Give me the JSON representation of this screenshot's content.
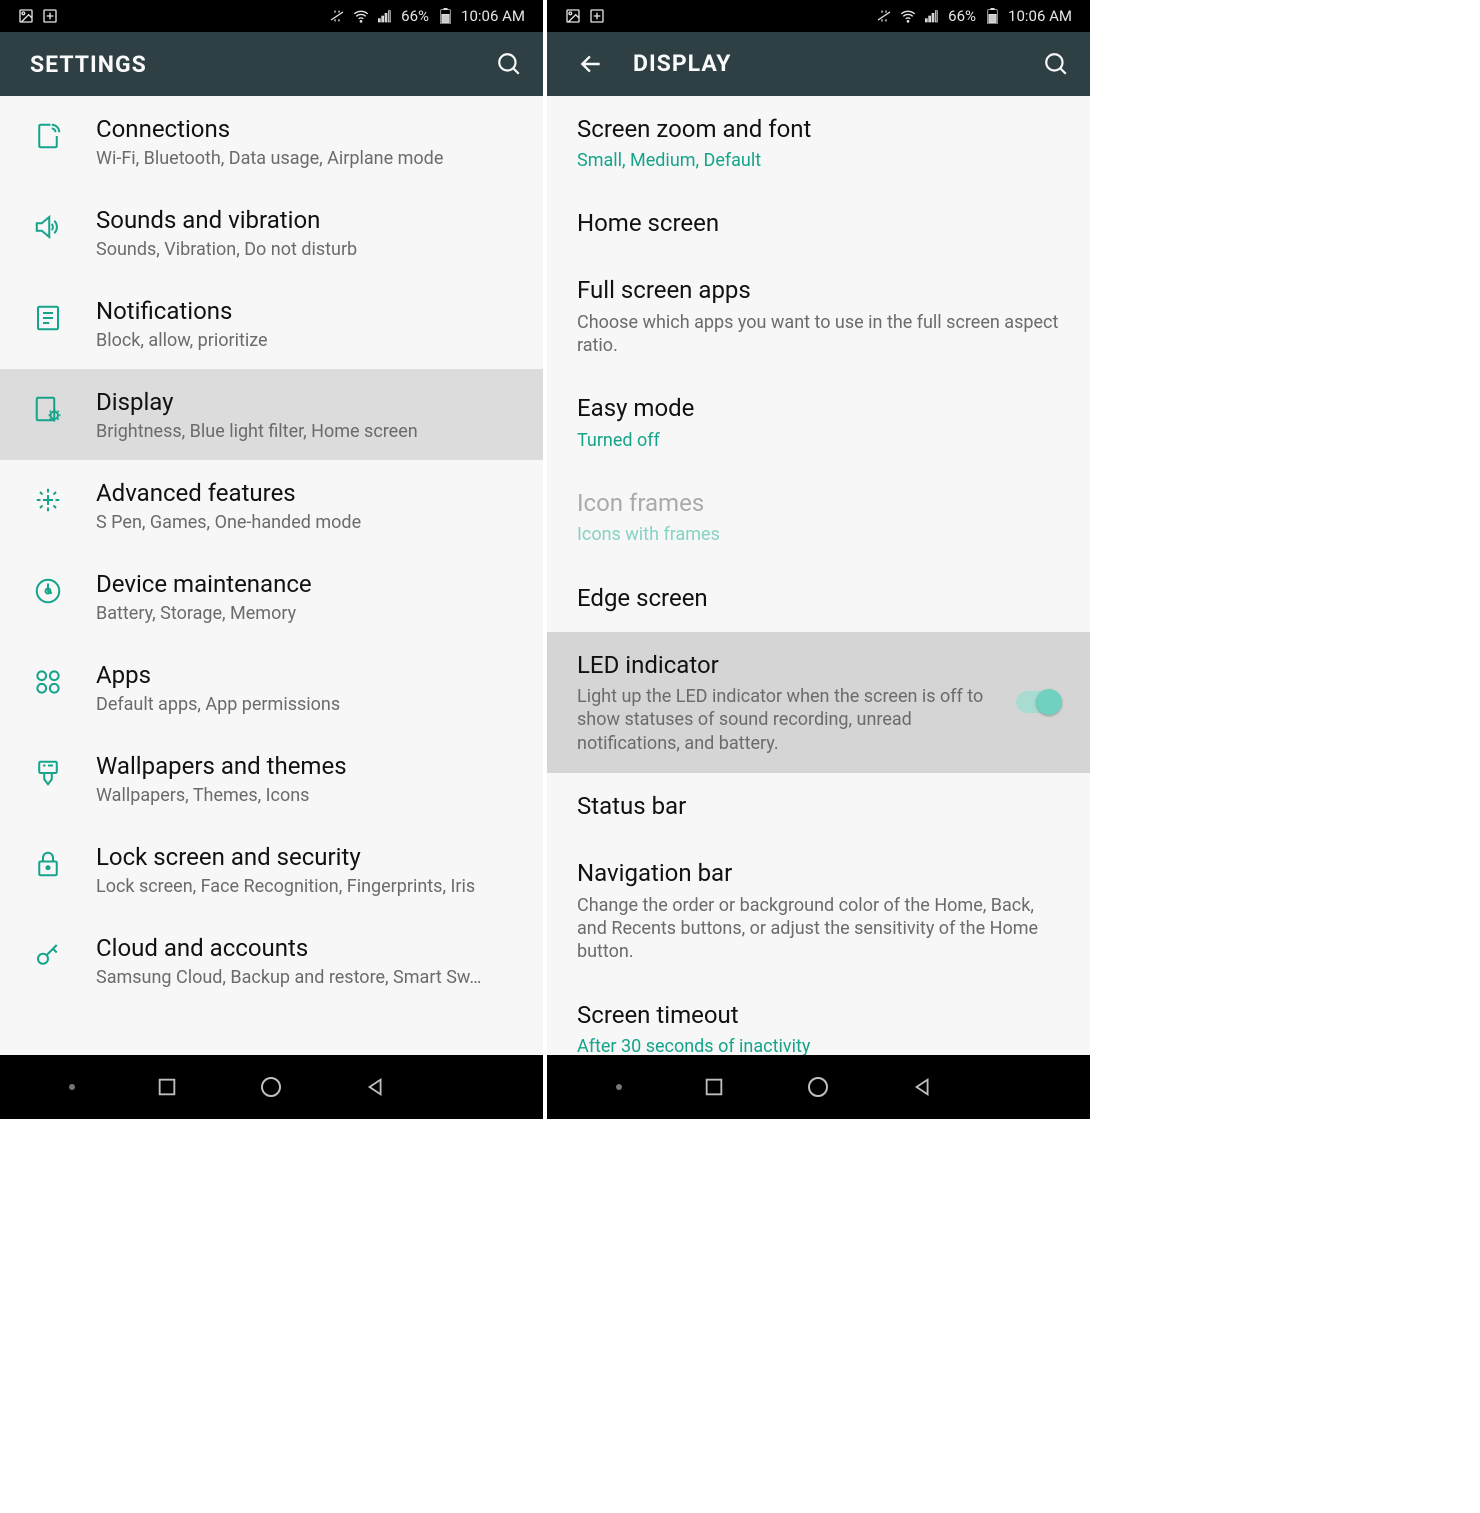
{
  "statusbar": {
    "battery_pct": "66%",
    "time": "10:06 AM"
  },
  "left": {
    "header_title": "SETTINGS",
    "items": [
      {
        "title": "Connections",
        "sub": "Wi-Fi, Bluetooth, Data usage, Airplane mode"
      },
      {
        "title": "Sounds and vibration",
        "sub": "Sounds, Vibration, Do not disturb"
      },
      {
        "title": "Notifications",
        "sub": "Block, allow, prioritize"
      },
      {
        "title": "Display",
        "sub": "Brightness, Blue light filter, Home screen"
      },
      {
        "title": "Advanced features",
        "sub": "S Pen, Games, One-handed mode"
      },
      {
        "title": "Device maintenance",
        "sub": "Battery, Storage, Memory"
      },
      {
        "title": "Apps",
        "sub": "Default apps, App permissions"
      },
      {
        "title": "Wallpapers and themes",
        "sub": "Wallpapers, Themes, Icons"
      },
      {
        "title": "Lock screen and security",
        "sub": "Lock screen, Face Recognition, Fingerprints, Iris"
      },
      {
        "title": "Cloud and accounts",
        "sub": "Samsung Cloud, Backup and restore, Smart Sw…"
      }
    ]
  },
  "right": {
    "header_title": "DISPLAY",
    "items": {
      "screen_zoom": {
        "title": "Screen zoom and font",
        "sub": "Small, Medium, Default"
      },
      "home_screen": {
        "title": "Home screen"
      },
      "full_screen": {
        "title": "Full screen apps",
        "sub": "Choose which apps you want to use in the full screen aspect ratio."
      },
      "easy_mode": {
        "title": "Easy mode",
        "sub": "Turned off"
      },
      "icon_frames": {
        "title": "Icon frames",
        "sub": "Icons with frames"
      },
      "edge_screen": {
        "title": "Edge screen"
      },
      "led": {
        "title": "LED indicator",
        "sub": "Light up the LED indicator when the screen is off to show statuses of sound recording, unread notifications, and battery."
      },
      "status_bar": {
        "title": "Status bar"
      },
      "nav_bar": {
        "title": "Navigation bar",
        "sub": "Change the order or background color of the Home, Back, and Recents buttons, or adjust the sensitivity of the Home button."
      },
      "screen_timeout": {
        "title": "Screen timeout",
        "sub": "After 30 seconds of inactivity"
      }
    }
  }
}
